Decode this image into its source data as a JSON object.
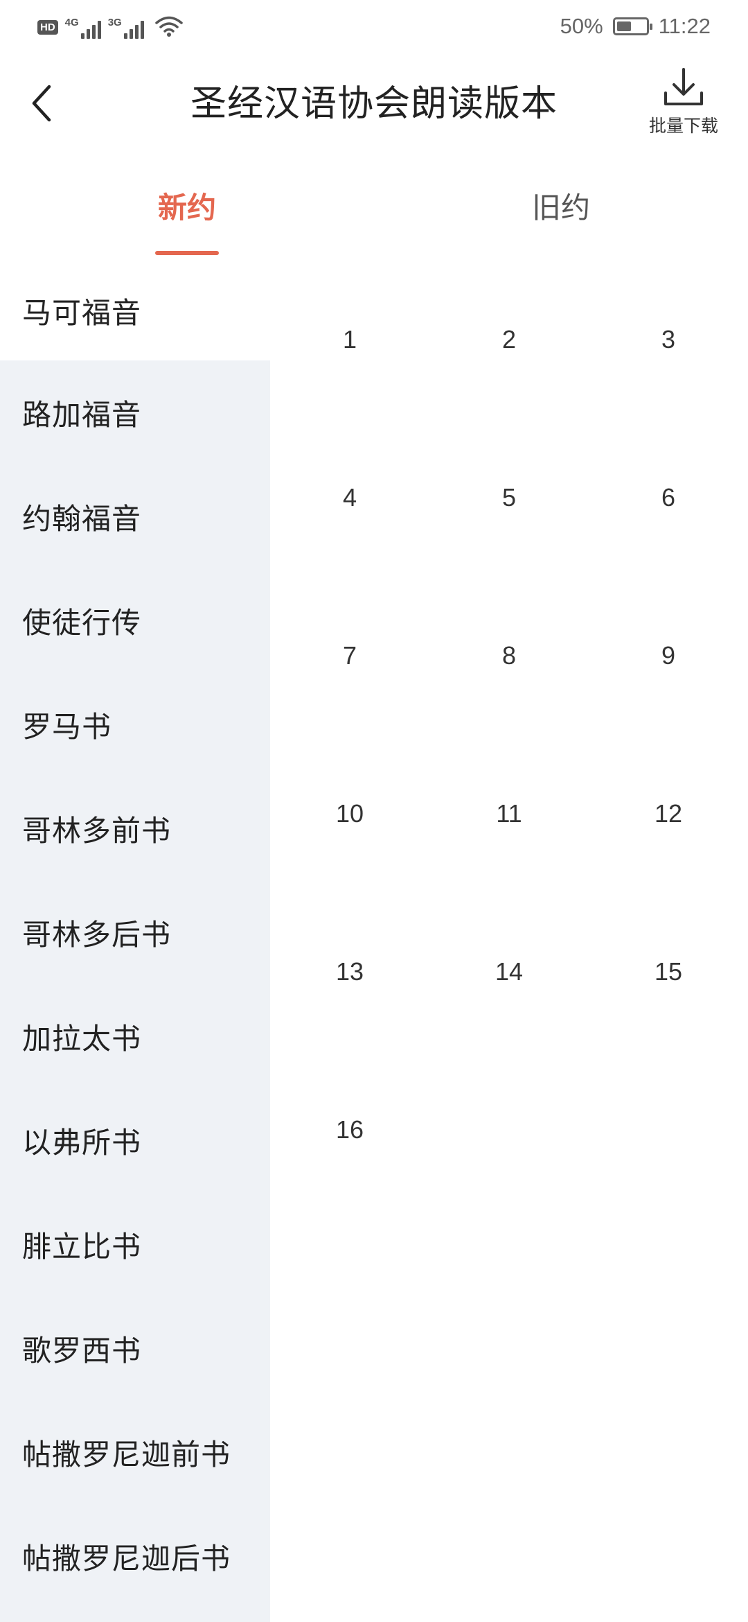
{
  "status_bar": {
    "hd": "HD",
    "network_1": "4G",
    "network_2": "3G",
    "battery_percent": "50%",
    "battery_level": 0.5,
    "time": "11:22"
  },
  "header": {
    "title": "圣经汉语协会朗读版本",
    "download_label": "批量下载"
  },
  "tabs": [
    {
      "label": "新约",
      "active": true
    },
    {
      "label": "旧约",
      "active": false
    }
  ],
  "books": [
    {
      "label": "马可福音",
      "active": true
    },
    {
      "label": "路加福音"
    },
    {
      "label": "约翰福音"
    },
    {
      "label": "使徒行传"
    },
    {
      "label": "罗马书"
    },
    {
      "label": "哥林多前书"
    },
    {
      "label": "哥林多后书"
    },
    {
      "label": "加拉太书"
    },
    {
      "label": "以弗所书"
    },
    {
      "label": "腓立比书"
    },
    {
      "label": "歌罗西书"
    },
    {
      "label": "帖撒罗尼迦前书"
    },
    {
      "label": "帖撒罗尼迦后书"
    }
  ],
  "chapters": [
    "1",
    "2",
    "3",
    "4",
    "5",
    "6",
    "7",
    "8",
    "9",
    "10",
    "11",
    "12",
    "13",
    "14",
    "15",
    "16"
  ],
  "colors": {
    "accent": "#e4674f",
    "sidebar_bg": "#eff2f6"
  }
}
